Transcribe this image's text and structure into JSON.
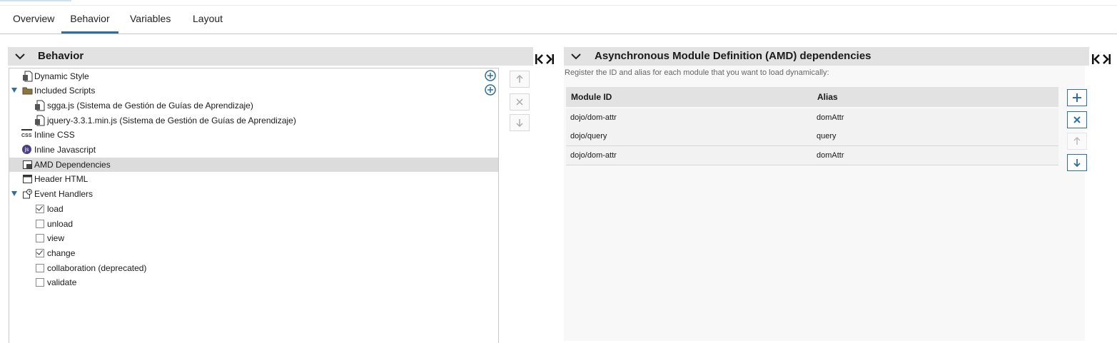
{
  "tabs": [
    {
      "label": "Overview"
    },
    {
      "label": "Behavior",
      "active": true
    },
    {
      "label": "Variables"
    },
    {
      "label": "Layout"
    }
  ],
  "left_panel": {
    "title": "Behavior",
    "tree": [
      {
        "label": "Dynamic Style",
        "icon": "script-file-icon"
      },
      {
        "label": "Included Scripts",
        "icon": "folder-icon",
        "expanded": true
      },
      {
        "label": "sgga.js (Sistema de Gestión de Guías de Aprendizaje)",
        "icon": "script-file-icon"
      },
      {
        "label": "jquery-3.3.1.min.js (Sistema de Gestión de Guías de Aprendizaje)",
        "icon": "script-file-icon"
      },
      {
        "label": "Inline CSS",
        "icon": "css-icon"
      },
      {
        "label": "Inline Javascript",
        "icon": "js-icon"
      },
      {
        "label": "AMD Dependencies",
        "icon": "amd-icon",
        "selected": true
      },
      {
        "label": "Header HTML",
        "icon": "html-header-icon"
      },
      {
        "label": "Event Handlers",
        "icon": "event-handler-icon",
        "expanded": true
      }
    ],
    "events": [
      {
        "label": "load",
        "checked": true
      },
      {
        "label": "unload",
        "checked": false
      },
      {
        "label": "view",
        "checked": false
      },
      {
        "label": "change",
        "checked": true
      },
      {
        "label": "collaboration (deprecated)",
        "checked": false
      },
      {
        "label": "validate",
        "checked": false
      }
    ],
    "css_icon_text": "CSS",
    "js_icon_text": "js"
  },
  "right_panel": {
    "title": "Asynchronous Module Definition (AMD) dependencies",
    "description": "Register the ID and alias for each module that you want to load dynamically:",
    "columns": [
      "Module ID",
      "Alias"
    ],
    "rows": [
      {
        "module_id": "dojo/dom-attr",
        "alias": "domAttr"
      },
      {
        "module_id": "dojo/query",
        "alias": "query"
      },
      {
        "module_id": "dojo/dom-attr",
        "alias": "domAttr"
      }
    ]
  },
  "colors": {
    "accent": "#2f6f9f",
    "header_bg": "#e2e2e2",
    "selected_row": "#dcdcdc"
  }
}
